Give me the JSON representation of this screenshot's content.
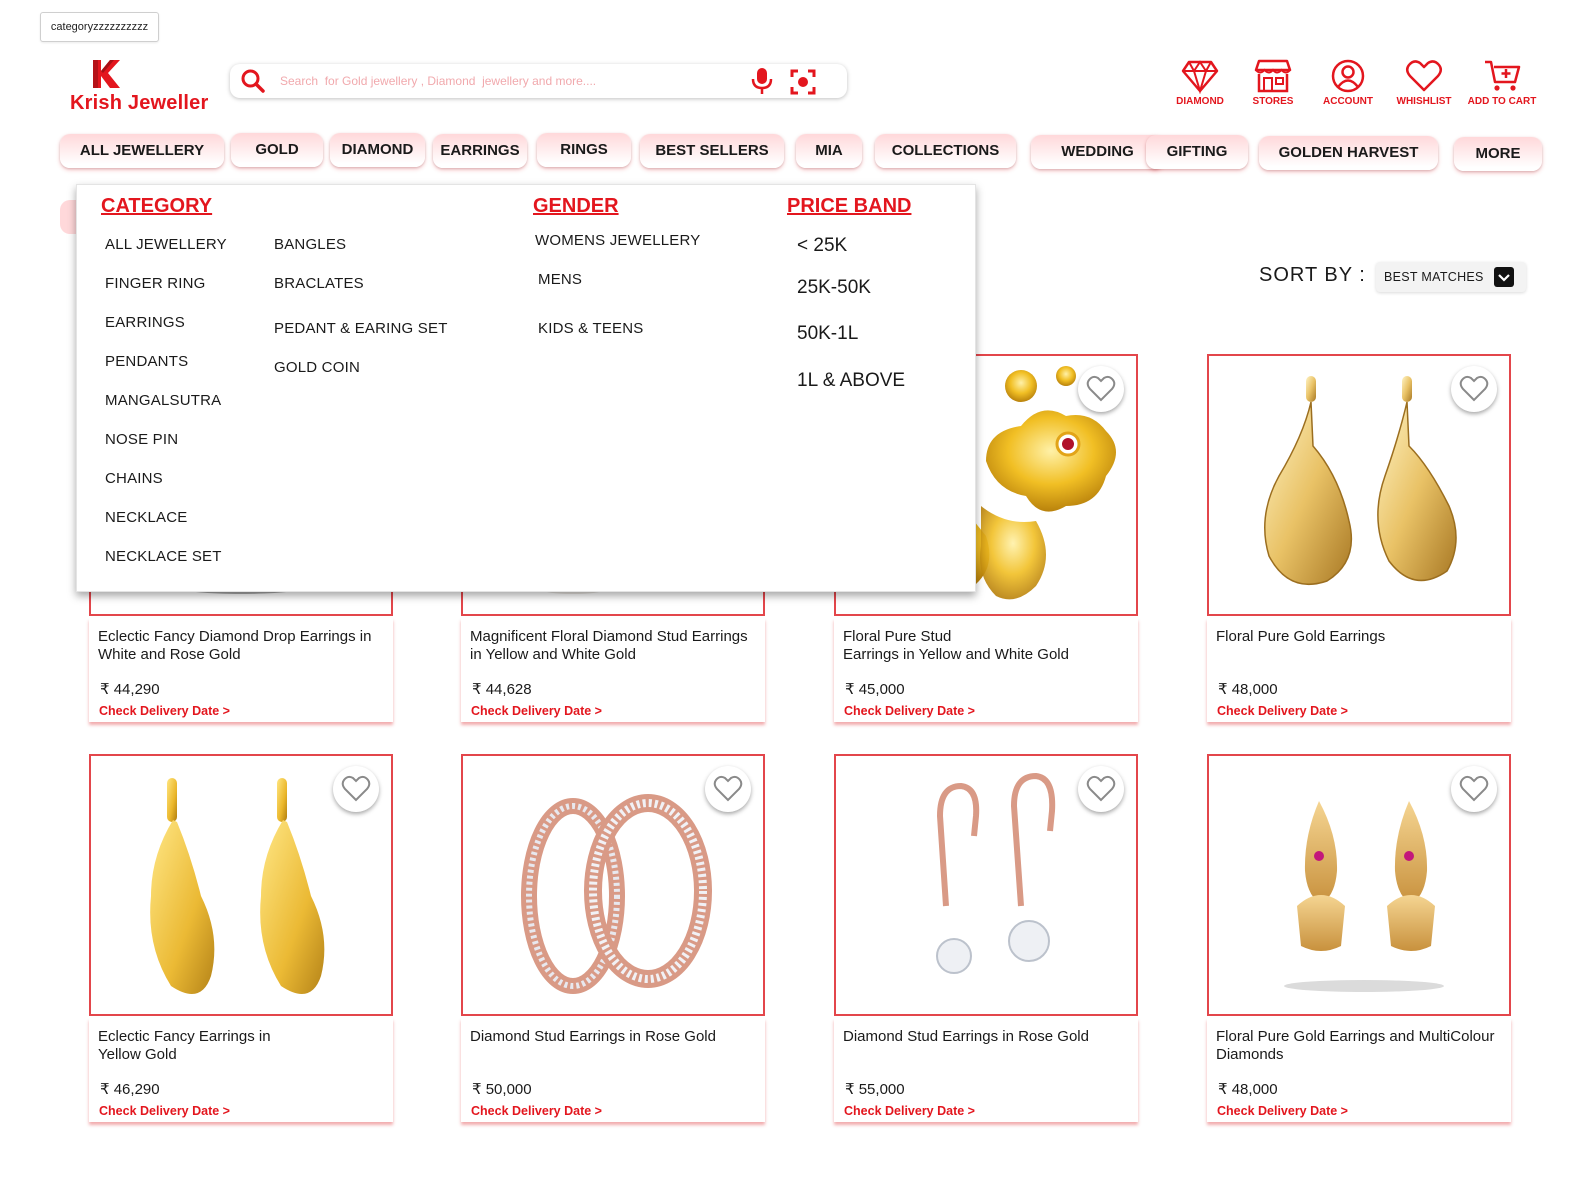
{
  "frame_label": "categoryzzzzzzzzzz",
  "brand": {
    "name": "Krish Jeweller",
    "color": "#e3161e"
  },
  "search": {
    "placeholder": "Search  for Gold jewellery , Diamond  jewellery and more....",
    "value": ""
  },
  "header_actions": [
    {
      "label": "DIAMOND",
      "icon": "diamond-icon"
    },
    {
      "label": "STORES",
      "icon": "store-icon"
    },
    {
      "label": "ACCOUNT",
      "icon": "account-icon"
    },
    {
      "label": "WHISHLIST",
      "icon": "heart-icon"
    },
    {
      "label": "ADD TO CART",
      "icon": "cart-icon"
    }
  ],
  "nav": [
    "ALL JEWELLERY",
    "GOLD",
    "DIAMOND",
    "EARRINGS",
    "RINGS",
    "BEST SELLERS",
    "MIA",
    "COLLECTIONS",
    "WEDDING",
    "GIFTING",
    "GOLDEN HARVEST",
    "MORE"
  ],
  "dropdown": {
    "category": {
      "heading": "CATEGORY",
      "col1": [
        "ALL JEWELLERY",
        "FINGER RING",
        "EARRINGS",
        "PENDANTS",
        "MANGALSUTRA",
        "NOSE PIN",
        "CHAINS",
        "NECKLACE",
        "NECKLACE SET"
      ],
      "col2": [
        "BANGLES",
        "BRACLATES",
        "PEDANT & EARING SET",
        "GOLD COIN"
      ]
    },
    "gender": {
      "heading": "GENDER",
      "items": [
        "WOMENS JEWELLERY",
        "MENS",
        "KIDS & TEENS"
      ]
    },
    "price_band": {
      "heading": "PRICE BAND",
      "items": [
        "< 25K",
        "25K-50K",
        "50K-1L",
        "1L & ABOVE"
      ]
    }
  },
  "sort": {
    "label": "SORT BY :",
    "value": "BEST MATCHES"
  },
  "products": [
    {
      "title": "Eclectic Fancy Diamond Drop Earrings in White and Rose Gold",
      "price": "₹ 44,290",
      "link": "Check Delivery Date >"
    },
    {
      "title": "Magnificent Floral Diamond Stud Earrings in Yellow and White Gold",
      "price": "₹ 44,628",
      "link": "Check Delivery Date >"
    },
    {
      "title": "Floral Pure Stud\nEarrings in Yellow and White Gold",
      "price": "₹ 45,000",
      "link": "Check Delivery Date >"
    },
    {
      "title": "Floral Pure Gold Earrings",
      "price": "₹ 48,000",
      "link": "Check Delivery Date >"
    },
    {
      "title": "Eclectic Fancy Earrings in\nYellow Gold",
      "price": "₹ 46,290",
      "link": "Check Delivery Date >"
    },
    {
      "title": "Diamond Stud Earrings in Rose Gold",
      "price": "₹ 50,000",
      "link": "Check Delivery Date >"
    },
    {
      "title": "Diamond Stud Earrings in Rose Gold",
      "price": "₹ 55,000",
      "link": "Check Delivery Date >"
    },
    {
      "title": "Floral Pure Gold Earrings and MultiColour Diamonds",
      "price": "₹ 48,000",
      "link": "Check Delivery Date >"
    }
  ],
  "colors": {
    "accent": "#e3161e",
    "card_border": "#e3464b",
    "pill_tint": "#ffd8da",
    "gold": "#e2b33a",
    "rose_gold": "#d99a86"
  }
}
